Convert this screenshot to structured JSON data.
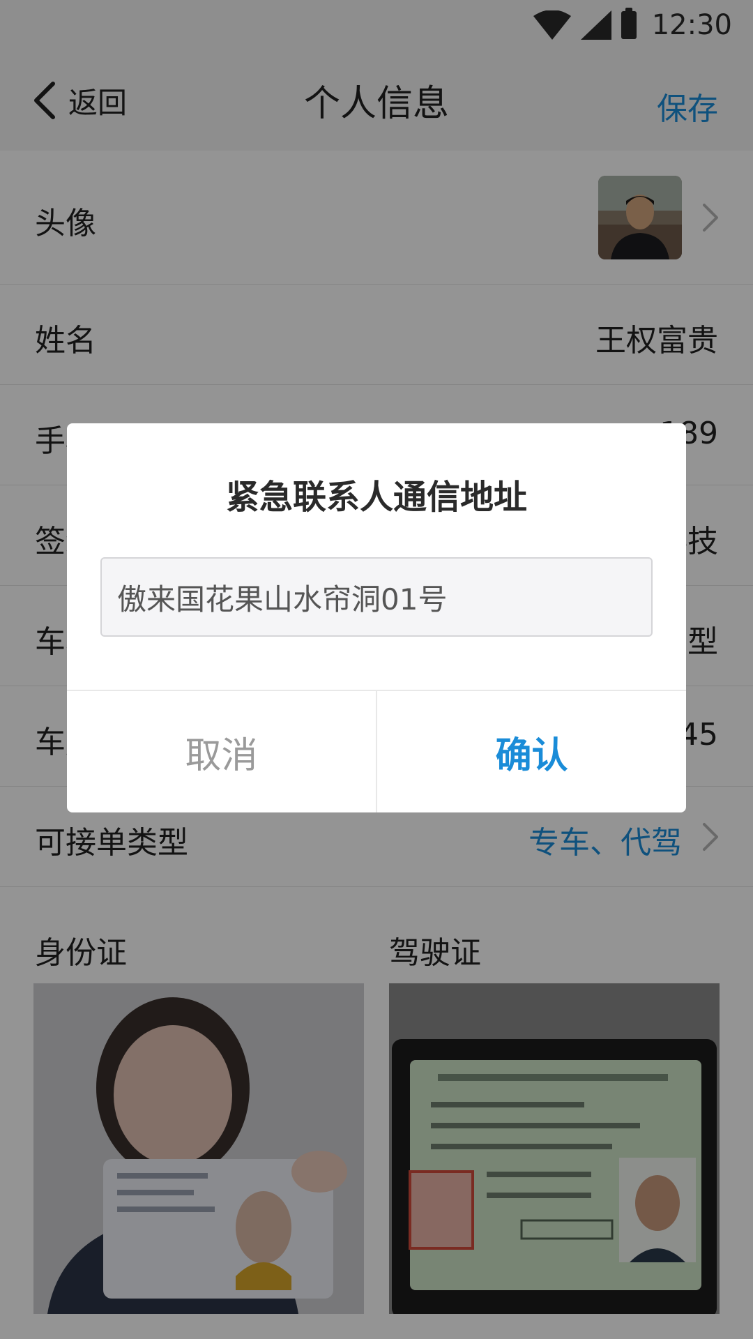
{
  "status_bar": {
    "time": "12:30"
  },
  "nav": {
    "back_label": "返回",
    "title": "个人信息",
    "save_label": "保存"
  },
  "rows": [
    {
      "label": "头像",
      "value": ""
    },
    {
      "label": "姓名",
      "value": "王权富贵"
    },
    {
      "label": "手机号",
      "value": "189"
    },
    {
      "label": "签约公司",
      "value": "科技"
    },
    {
      "label": "车辆类型",
      "value": "型"
    },
    {
      "label": "车牌号",
      "value": "45"
    },
    {
      "label": "可接单类型",
      "value": "专车、代驾"
    }
  ],
  "documents": {
    "id_card_label": "身份证",
    "license_label": "驾驶证"
  },
  "dialog": {
    "title": "紧急联系人通信地址",
    "input_value": "傲来国花果山水帘洞01号",
    "cancel_label": "取消",
    "confirm_label": "确认"
  },
  "colors": {
    "accent": "#1a8cd8",
    "overlay": "rgba(0,0,0,0.42)"
  }
}
